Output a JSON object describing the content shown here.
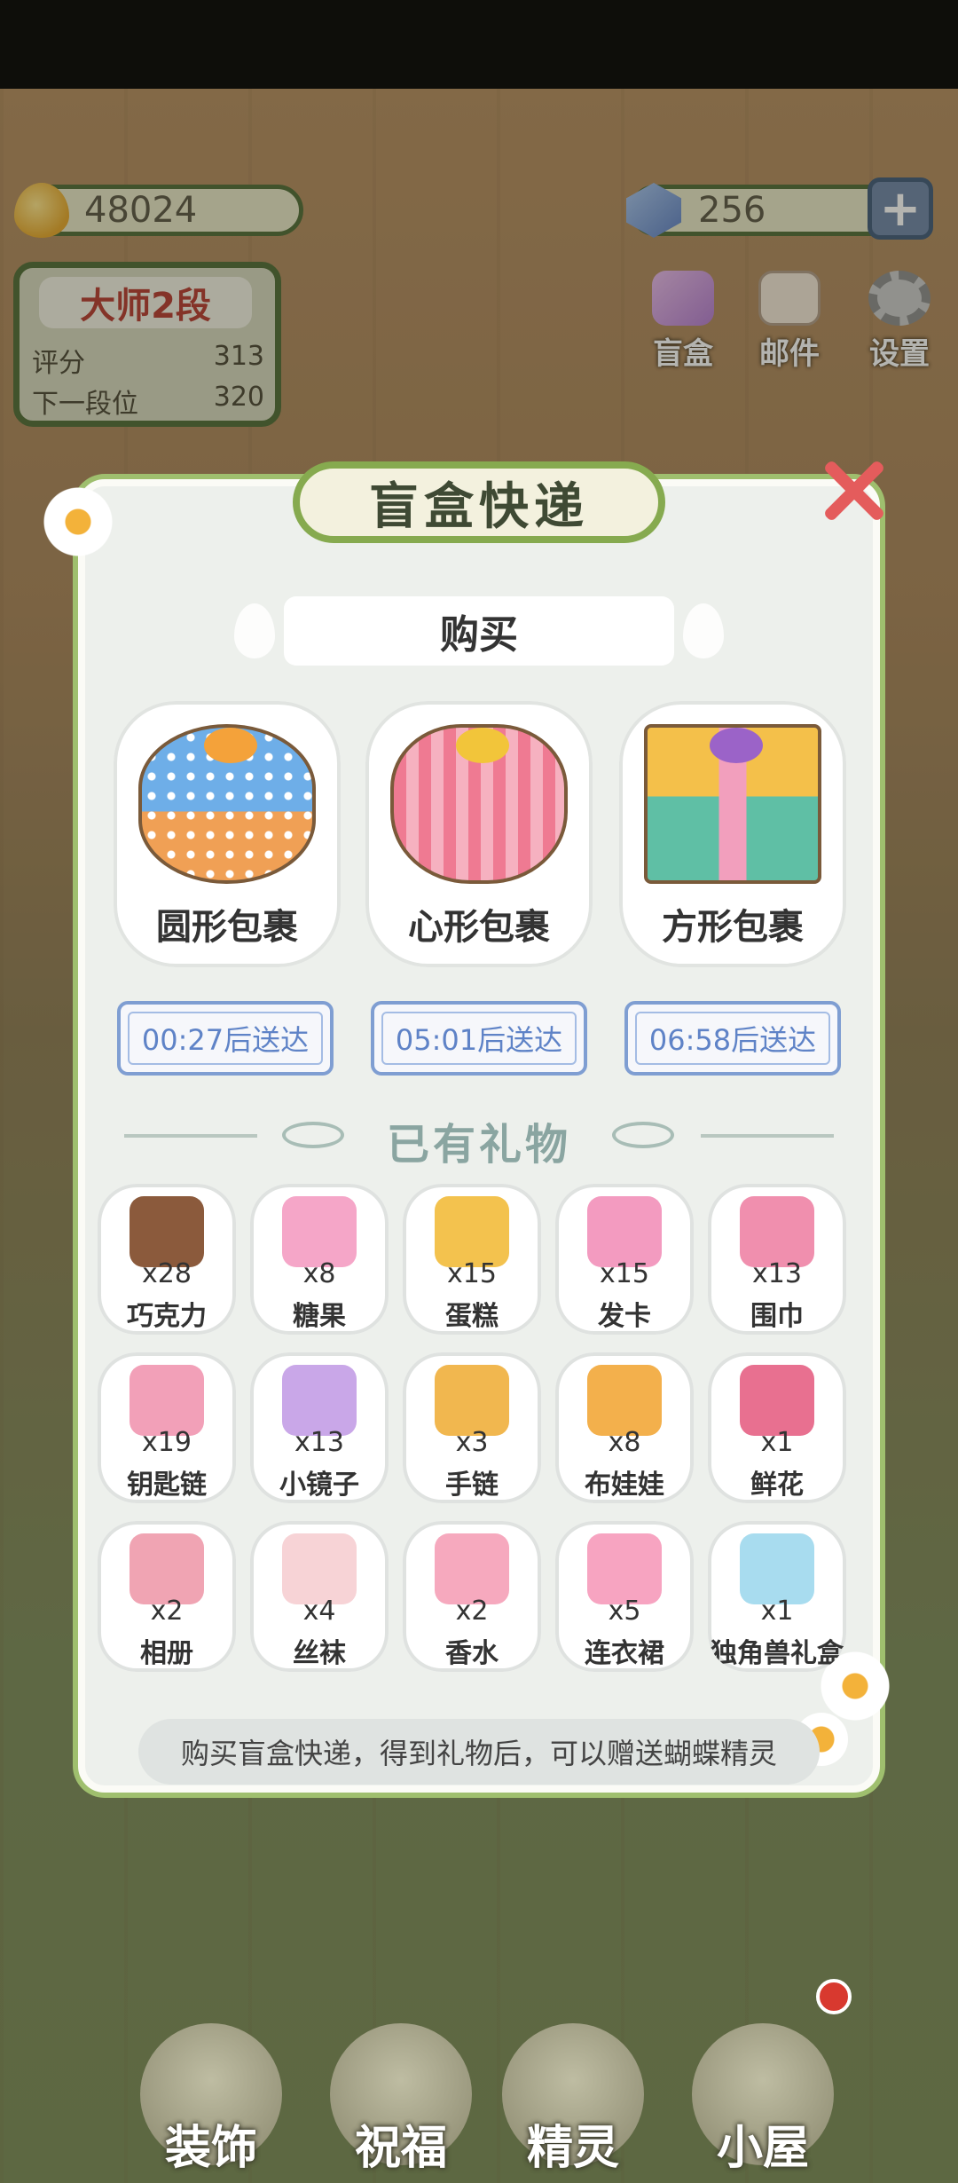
{
  "hud": {
    "coins": "48024",
    "gems": "256",
    "add_label": "+"
  },
  "rank": {
    "title": "大师2段",
    "score_label": "评分",
    "score_value": "313",
    "next_label": "下一段位",
    "next_value": "320"
  },
  "top_menu": {
    "blindbox": "盲盒",
    "mail": "邮件",
    "settings": "设置"
  },
  "modal": {
    "title": "盲盒快递",
    "buy_section": "购买",
    "packages": [
      {
        "label": "圆形包裹",
        "timer": "00:27后送达"
      },
      {
        "label": "心形包裹",
        "timer": "05:01后送达"
      },
      {
        "label": "方形包裹",
        "timer": "06:58后送达"
      }
    ],
    "owned_title": "已有礼物",
    "items": [
      {
        "name": "巧克力",
        "count": "x28",
        "color": "#8b5a3c"
      },
      {
        "name": "糖果",
        "count": "x8",
        "color": "#f5a6c8"
      },
      {
        "name": "蛋糕",
        "count": "x15",
        "color": "#f3c24e"
      },
      {
        "name": "发卡",
        "count": "x15",
        "color": "#f39bc0"
      },
      {
        "name": "围巾",
        "count": "x13",
        "color": "#f08fae"
      },
      {
        "name": "钥匙链",
        "count": "x19",
        "color": "#f2a0b8"
      },
      {
        "name": "小镜子",
        "count": "x13",
        "color": "#c9a7e8"
      },
      {
        "name": "手链",
        "count": "x3",
        "color": "#f1b74f"
      },
      {
        "name": "布娃娃",
        "count": "x8",
        "color": "#f3b04c"
      },
      {
        "name": "鲜花",
        "count": "x1",
        "color": "#e87090"
      },
      {
        "name": "相册",
        "count": "x2",
        "color": "#f0a4b3"
      },
      {
        "name": "丝袜",
        "count": "x4",
        "color": "#f7d3d6"
      },
      {
        "name": "香水",
        "count": "x2",
        "color": "#f6a9be"
      },
      {
        "name": "连衣裙",
        "count": "x5",
        "color": "#f7a4c1"
      },
      {
        "name": "独角兽礼盒",
        "count": "x1",
        "color": "#a8dcef"
      }
    ],
    "hint": "购买盲盒快递，得到礼物后，可以赠送蝴蝶精灵"
  },
  "bottom_nav": [
    {
      "label": "装饰"
    },
    {
      "label": "祝福"
    },
    {
      "label": "精灵"
    },
    {
      "label": "小屋"
    }
  ]
}
